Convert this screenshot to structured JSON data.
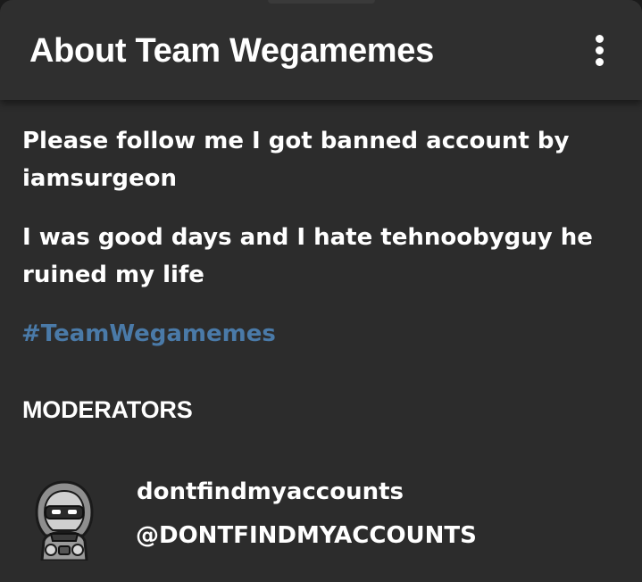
{
  "header": {
    "title": "About Team Wegamemes",
    "menu_icon": "more-vertical-icon"
  },
  "about": {
    "paragraphs": [
      "Please follow me I got banned account by iamsurgeon",
      "I was good days and I hate tehnoobyguy he ruined my life"
    ],
    "hashtag": "#TeamWegamemes"
  },
  "moderators": {
    "section_title": "MODERATORS",
    "items": [
      {
        "name": "dontfindmyaccounts",
        "handle": "@DONTFINDMYACCOUNTS",
        "avatar_icon": "hooded-ninja-avatar"
      }
    ]
  },
  "colors": {
    "background": "#2c2c2c",
    "header": "#2f2f2f",
    "text": "#ffffff",
    "hashtag": "#4a7aa8"
  }
}
